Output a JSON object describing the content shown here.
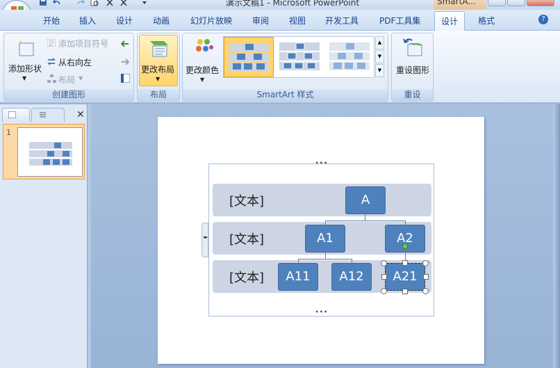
{
  "window": {
    "title": "演示文稿1 - Microsoft PowerPoint",
    "contextual_title": "SmartA..."
  },
  "tabs": [
    {
      "label": "开始"
    },
    {
      "label": "插入"
    },
    {
      "label": "设计"
    },
    {
      "label": "动画"
    },
    {
      "label": "幻灯片放映"
    },
    {
      "label": "审阅"
    },
    {
      "label": "视图"
    },
    {
      "label": "开发工具"
    },
    {
      "label": "PDF工具集"
    },
    {
      "label": "设计",
      "active": true
    },
    {
      "label": "格式"
    }
  ],
  "ribbon": {
    "create_graphic": {
      "label": "创建图形",
      "add_shape": "添加形状",
      "add_bullet": "添加项目符号",
      "right_to_left": "从右向左",
      "layout": "布局"
    },
    "layouts": {
      "label": "布局",
      "change_layout": "更改布局"
    },
    "smartart_styles": {
      "label": "SmartArt 样式",
      "change_colors": "更改颜色"
    },
    "reset": {
      "label": "重设",
      "reset_graphic": "重设图形"
    }
  },
  "thumbnails": {
    "slide_number": "1"
  },
  "smartart": {
    "rows": [
      "[文本]",
      "[文本]",
      "[文本]"
    ],
    "nodes": {
      "a": "A",
      "a1": "A1",
      "a2": "A2",
      "a11": "A11",
      "a12": "A12",
      "a21": "A21"
    }
  },
  "colors": {
    "node_fill": "#4f81bd",
    "band_fill": "#cdd5e4",
    "ribbon_text": "#15428b",
    "selected_thumb": "#fcd9a6"
  }
}
